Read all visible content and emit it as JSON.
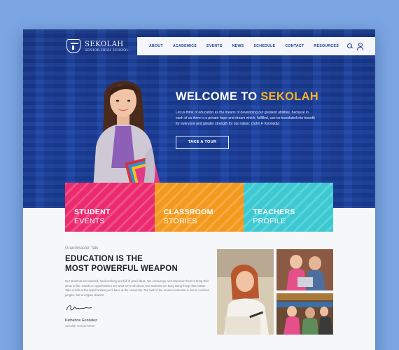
{
  "brand": {
    "name": "SEKOLAH",
    "subtitle": "SENIOR HIGH SCHOOL"
  },
  "nav": {
    "items": [
      "ABOUT",
      "ACADEMICS",
      "EVENTS",
      "NEWS",
      "SCHEDULE",
      "CONTACT",
      "RESOURCES"
    ],
    "icons": [
      "search-icon",
      "user-icon"
    ]
  },
  "hero": {
    "title_prefix": "WELCOME TO ",
    "title_highlight": "SEKOLAH",
    "body": "Let us think of education as the means of developing our greatest abilities, because in each of us there is a private hope and dream which, fulfilled, can be translated into benefit for everyone and greater strength for our nation. ",
    "quote_author": "(John F. Kennedy)",
    "cta": "TAKE A TOUR"
  },
  "cards": [
    {
      "line1": "STUDENT",
      "line2": "EVENTS",
      "color": "#ec2b6e"
    },
    {
      "line1": "CLASSROOM",
      "line2": "STORIES",
      "color": "#f39a1e"
    },
    {
      "line1": "TEACHERS",
      "line2": "PROFILE",
      "color": "#3cc9d2"
    }
  ],
  "talk": {
    "kicker": "Grandmaster Talk",
    "heading_line1": "EDUCATION IS THE",
    "heading_line2": "MOST POWERFUL WEAPON",
    "body": "Our students are talented, hard-working and full of good ideas. We encourage and empower them to bring their ideas to life. Hands-on opportunities are what we're all about. Our students are busy doing things that matter. Take a look at the opportunities you'll have at the University. The task of the modern educator is not to cut down jungles, but to irrigate deserts.",
    "signature": "Signature",
    "name": "Katherine Gonzalez",
    "role": "Sekolah Grandmaster"
  },
  "colors": {
    "hero_blue": "#1e45a8",
    "accent_yellow": "#f8b227",
    "pink": "#ec2b6e",
    "orange": "#f39a1e",
    "cyan": "#3cc9d2"
  }
}
